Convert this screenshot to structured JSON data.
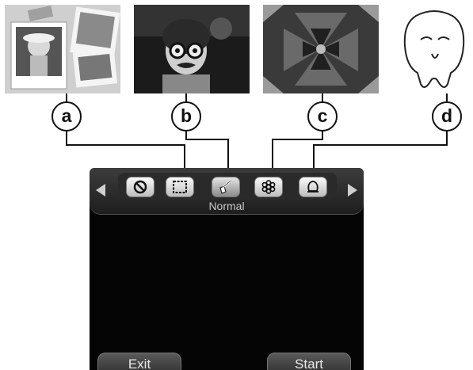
{
  "callouts": {
    "a": "a",
    "b": "b",
    "c": "c",
    "d": "d"
  },
  "filter_bar": {
    "current_filter": "Normal",
    "icons": [
      "no-effect-icon",
      "frame-icon",
      "sketch-brush-icon",
      "kaleidoscope-icon",
      "face-outline-icon"
    ],
    "selected_index": 2
  },
  "buttons": {
    "exit": "Exit",
    "start": "Start"
  },
  "colors": {
    "screen_bg": "#050505",
    "bar_bg": "#2e2e2e",
    "button_face": "#e6e6e6"
  }
}
